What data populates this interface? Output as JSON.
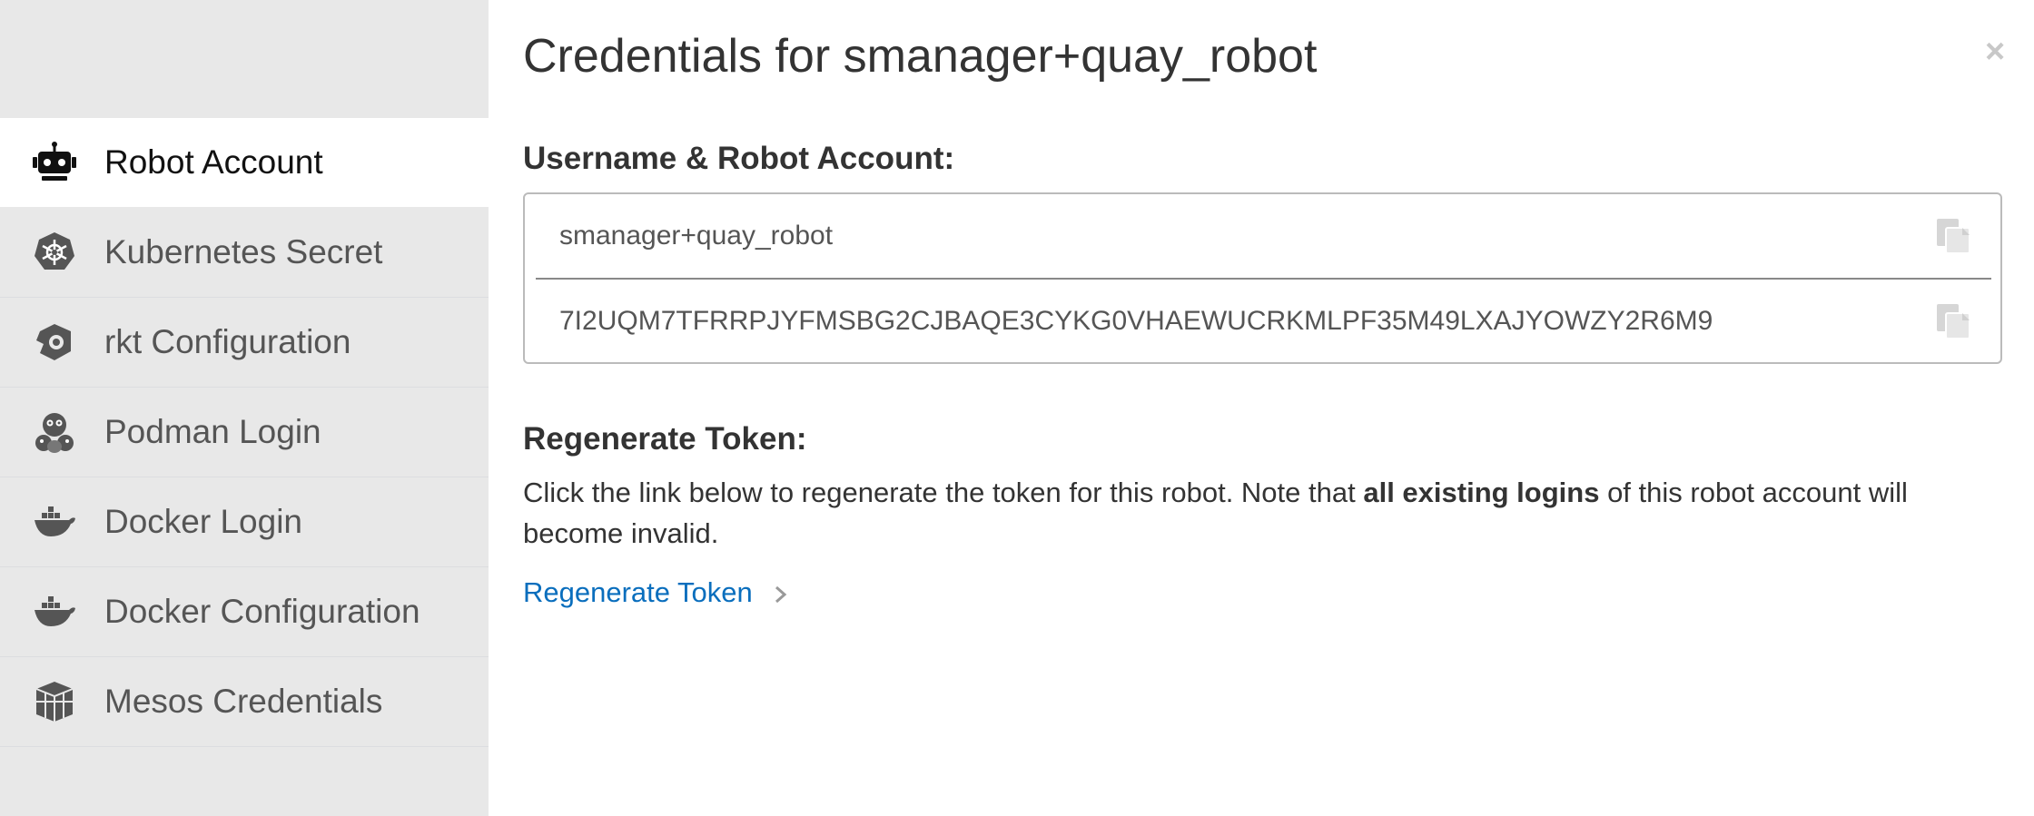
{
  "sidebar": {
    "items": [
      {
        "label": "Robot Account",
        "icon": "robot-icon",
        "active": true
      },
      {
        "label": "Kubernetes Secret",
        "icon": "kubernetes-icon",
        "active": false
      },
      {
        "label": "rkt Configuration",
        "icon": "rkt-icon",
        "active": false
      },
      {
        "label": "Podman Login",
        "icon": "podman-icon",
        "active": false
      },
      {
        "label": "Docker Login",
        "icon": "docker-icon",
        "active": false
      },
      {
        "label": "Docker Configuration",
        "icon": "docker-icon",
        "active": false
      },
      {
        "label": "Mesos Credentials",
        "icon": "mesos-icon",
        "active": false
      }
    ]
  },
  "dialog": {
    "title": "Credentials for smanager+quay_robot",
    "close_symbol": "×"
  },
  "credentials": {
    "heading": "Username & Robot Account:",
    "username": "smanager+quay_robot",
    "token": "7I2UQM7TFRRPJYFMSBG2CJBAQE3CYKG0VHAEWUCRKMLPF35M49LXAJYOWZY2R6M9"
  },
  "regenerate": {
    "heading": "Regenerate Token:",
    "desc_before": "Click the link below to regenerate the token for this robot. Note that ",
    "desc_bold": "all existing logins",
    "desc_after": " of this robot account will become invalid.",
    "link_label": "Regenerate Token"
  },
  "colors": {
    "sidebar_bg": "#e8e8e8",
    "active_bg": "#ffffff",
    "link": "#0a6ebd",
    "text": "#333333"
  }
}
